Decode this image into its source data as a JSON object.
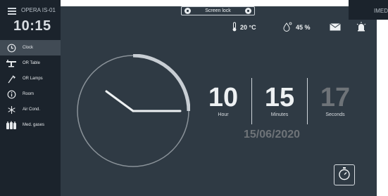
{
  "header": {
    "room_name": "OPERA IS-01",
    "time": "10:15",
    "corner_brand": "IMED",
    "screen_lock_label": "Screen lock"
  },
  "status": {
    "temperature": "20 °C",
    "humidity": "45 %",
    "icons": [
      "thermometer-icon",
      "humidity-drop-icon",
      "mail-icon",
      "alarm-light-icon"
    ]
  },
  "sidebar": {
    "items": [
      {
        "label": "Clock",
        "icon": "clock-icon",
        "active": true
      },
      {
        "label": "OR Table",
        "icon": "or-table-icon",
        "active": false
      },
      {
        "label": "OR Lamps",
        "icon": "or-lamps-icon",
        "active": false
      },
      {
        "label": "Room",
        "icon": "info-icon",
        "active": false
      },
      {
        "label": "Air Cond.",
        "icon": "snowflake-icon",
        "active": false
      },
      {
        "label": "Med. gases",
        "icon": "gas-cylinders-icon",
        "active": false
      }
    ]
  },
  "clock": {
    "hours": "10",
    "minutes": "15",
    "seconds": "17",
    "hour_label": "Hour",
    "minutes_label": "Minutes",
    "seconds_label": "Seconds",
    "date": "15/06/2020"
  },
  "colors": {
    "background": "#2f3a44",
    "sidebar": "#1b232c",
    "active_item": "#414b55",
    "text": "#eef1f3",
    "muted": "#6e7378"
  }
}
